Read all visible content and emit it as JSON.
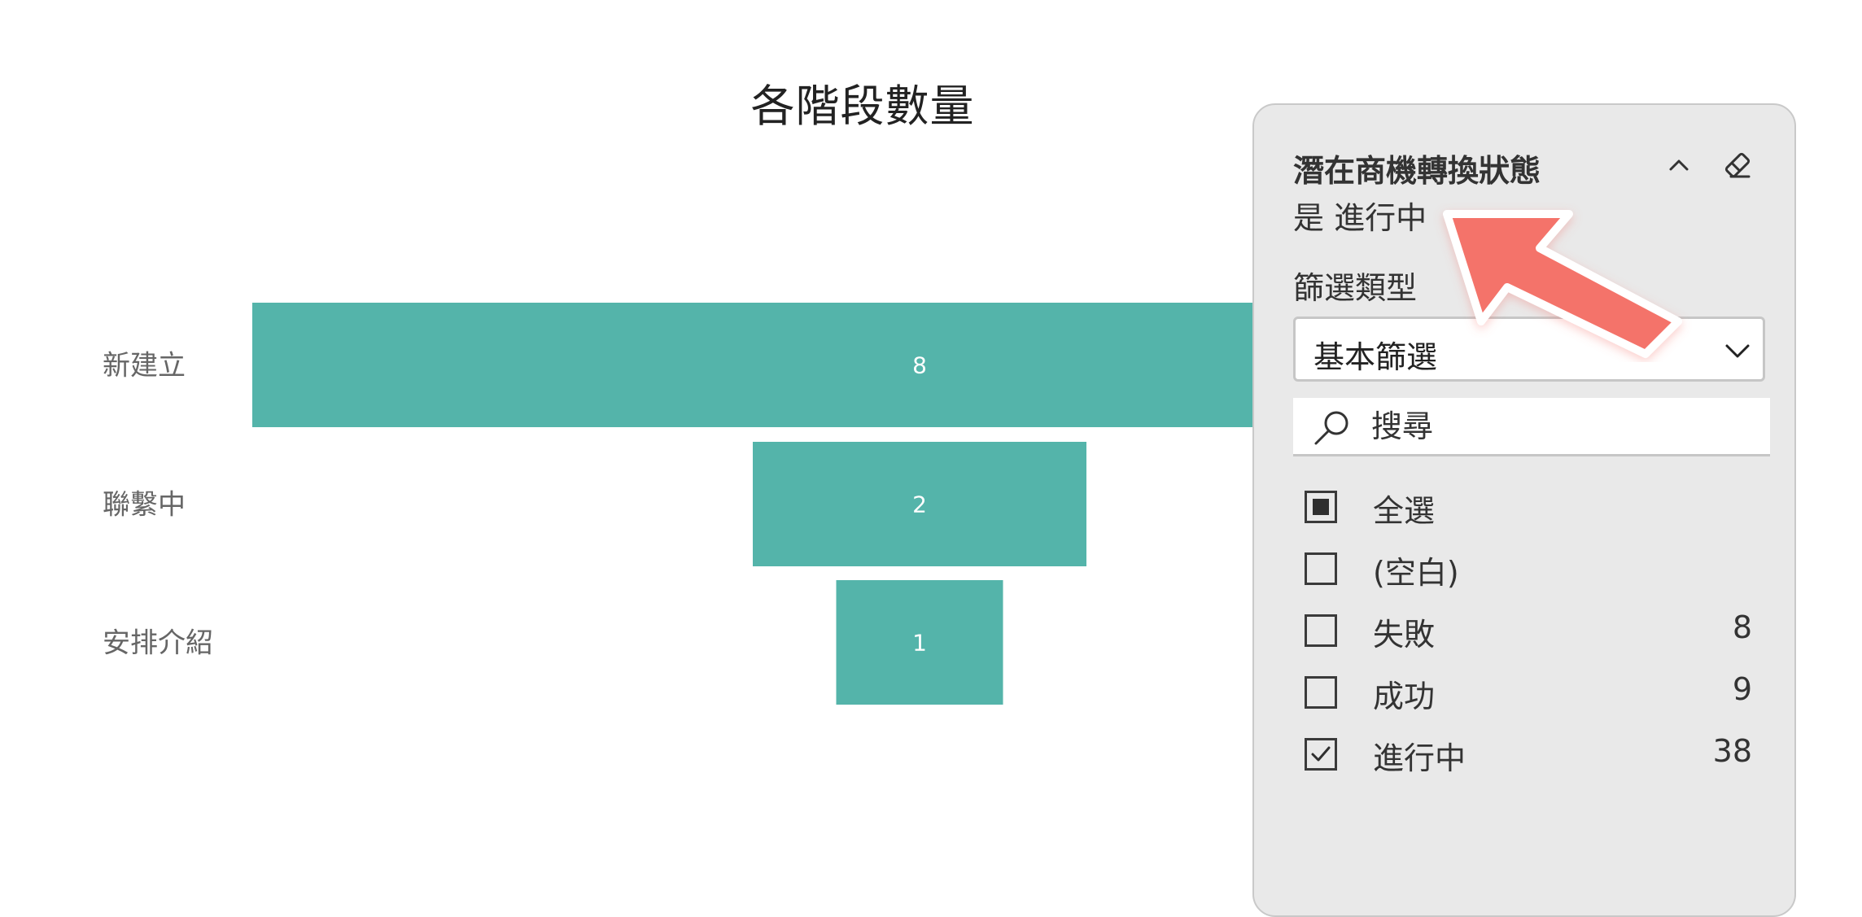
{
  "chart_data": {
    "type": "funnel",
    "title": "各階段數量",
    "categories": [
      "新建立",
      "聯繫中",
      "安排介紹"
    ],
    "values": [
      8,
      2,
      1
    ],
    "colors": {
      "bar": "#54b4aa"
    }
  },
  "filter_pane": {
    "field_name": "潛在商機轉換狀態",
    "summary": "是 進行中",
    "filter_type_label": "篩選類型",
    "filter_type_value": "基本篩選",
    "search_placeholder": "搜尋",
    "options": [
      {
        "label": "全選",
        "count": "",
        "state": "partial"
      },
      {
        "label": "(空白)",
        "count": "",
        "state": "unchecked"
      },
      {
        "label": "失敗",
        "count": "8",
        "state": "unchecked"
      },
      {
        "label": "成功",
        "count": "9",
        "state": "unchecked"
      },
      {
        "label": "進行中",
        "count": "38",
        "state": "checked"
      }
    ],
    "icons": {
      "collapse": "chevron-up-icon",
      "clear": "eraser-icon",
      "dropdown": "chevron-down-icon",
      "search": "search-icon"
    }
  },
  "annotation": {
    "color": "#f4736a"
  }
}
